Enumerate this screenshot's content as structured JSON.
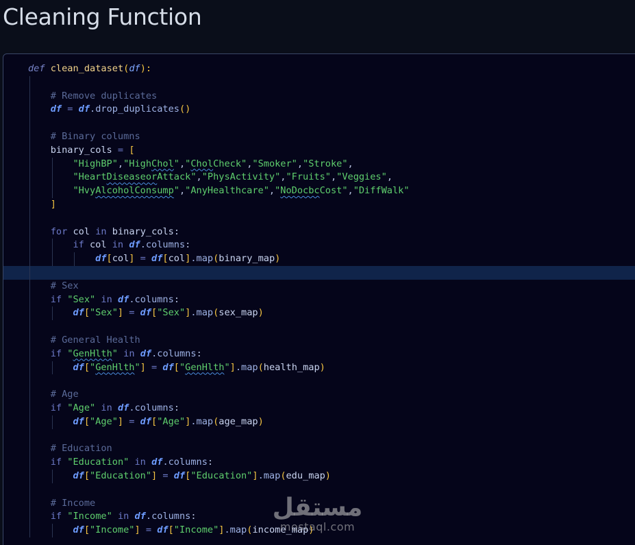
{
  "page": {
    "title": "Cleaning Function"
  },
  "code_lines": [
    {
      "indent": 0,
      "guides": [],
      "tokens": [
        [
          "kw-def",
          "def "
        ],
        [
          "fn",
          "clean_dataset"
        ],
        [
          "br",
          "("
        ],
        [
          "param",
          "df"
        ],
        [
          "br",
          "):"
        ]
      ]
    },
    {
      "indent": 1,
      "guides": [
        1
      ],
      "tokens": []
    },
    {
      "indent": 1,
      "guides": [
        1
      ],
      "tokens": [
        [
          "cmt",
          "# Remove duplicates"
        ]
      ]
    },
    {
      "indent": 1,
      "guides": [
        1
      ],
      "tokens": [
        [
          "dfv",
          "df"
        ],
        [
          "op",
          " = "
        ],
        [
          "dfv",
          "df"
        ],
        [
          "meth",
          ".drop_duplicates"
        ],
        [
          "br",
          "()"
        ]
      ]
    },
    {
      "indent": 1,
      "guides": [
        1
      ],
      "tokens": []
    },
    {
      "indent": 1,
      "guides": [
        1
      ],
      "tokens": [
        [
          "cmt",
          "# Binary columns"
        ]
      ]
    },
    {
      "indent": 1,
      "guides": [
        1
      ],
      "tokens": [
        [
          "var",
          "binary_cols"
        ],
        [
          "op",
          " = "
        ],
        [
          "br",
          "["
        ]
      ]
    },
    {
      "indent": 2,
      "guides": [
        1,
        2
      ],
      "tokens": [
        [
          "str",
          "\"HighBP\""
        ],
        [
          "punc",
          ","
        ],
        [
          "str",
          "\"High"
        ],
        [
          "str squig",
          "Chol"
        ],
        [
          "str",
          "\""
        ],
        [
          "punc",
          ","
        ],
        [
          "str",
          "\""
        ],
        [
          "str squig",
          "Chol"
        ],
        [
          "str",
          "Check\""
        ],
        [
          "punc",
          ","
        ],
        [
          "str",
          "\"Smoker\""
        ],
        [
          "punc",
          ","
        ],
        [
          "str",
          "\"Stroke\""
        ],
        [
          "punc",
          ","
        ]
      ]
    },
    {
      "indent": 2,
      "guides": [
        1,
        2
      ],
      "tokens": [
        [
          "str",
          "\"Heart"
        ],
        [
          "str squig",
          "Diseaseor"
        ],
        [
          "str",
          "Attack\""
        ],
        [
          "punc",
          ","
        ],
        [
          "str",
          "\"PhysActivity\""
        ],
        [
          "punc",
          ","
        ],
        [
          "str",
          "\"Fruits\""
        ],
        [
          "punc",
          ","
        ],
        [
          "str",
          "\"Veggies\""
        ],
        [
          "punc",
          ","
        ]
      ]
    },
    {
      "indent": 2,
      "guides": [
        1,
        2
      ],
      "tokens": [
        [
          "str",
          "\"Hvy"
        ],
        [
          "str squig",
          "AlcoholConsump"
        ],
        [
          "str",
          "\""
        ],
        [
          "punc",
          ","
        ],
        [
          "str",
          "\"AnyHealthcare\""
        ],
        [
          "punc",
          ","
        ],
        [
          "str",
          "\""
        ],
        [
          "str squig",
          "NoDocbc"
        ],
        [
          "str",
          "Cost\""
        ],
        [
          "punc",
          ","
        ],
        [
          "str",
          "\"DiffWalk\""
        ]
      ]
    },
    {
      "indent": 1,
      "guides": [
        1
      ],
      "tokens": [
        [
          "br",
          "]"
        ]
      ]
    },
    {
      "indent": 1,
      "guides": [
        1
      ],
      "tokens": []
    },
    {
      "indent": 1,
      "guides": [
        1
      ],
      "tokens": [
        [
          "kw",
          "for "
        ],
        [
          "var",
          "col"
        ],
        [
          "kw",
          " in "
        ],
        [
          "var",
          "binary_cols"
        ],
        [
          "punc",
          ":"
        ]
      ]
    },
    {
      "indent": 2,
      "guides": [
        1,
        2
      ],
      "tokens": [
        [
          "kw",
          "if "
        ],
        [
          "var",
          "col"
        ],
        [
          "kw",
          " in "
        ],
        [
          "dfv",
          "df"
        ],
        [
          "meth",
          ".columns"
        ],
        [
          "punc",
          ":"
        ]
      ]
    },
    {
      "indent": 3,
      "guides": [
        1,
        2,
        3
      ],
      "tokens": [
        [
          "dfv",
          "df"
        ],
        [
          "br",
          "["
        ],
        [
          "var",
          "col"
        ],
        [
          "br",
          "]"
        ],
        [
          "op",
          " = "
        ],
        [
          "dfv",
          "df"
        ],
        [
          "br",
          "["
        ],
        [
          "var",
          "col"
        ],
        [
          "br",
          "]"
        ],
        [
          "meth",
          ".map"
        ],
        [
          "br",
          "("
        ],
        [
          "var",
          "binary_map"
        ],
        [
          "br",
          ")"
        ]
      ]
    },
    {
      "indent": 1,
      "guides": [
        1
      ],
      "active": true,
      "tokens": []
    },
    {
      "indent": 1,
      "guides": [
        1
      ],
      "tokens": [
        [
          "cmt",
          "# Sex"
        ]
      ]
    },
    {
      "indent": 1,
      "guides": [
        1
      ],
      "tokens": [
        [
          "kw",
          "if "
        ],
        [
          "str",
          "\"Sex\""
        ],
        [
          "kw",
          " in "
        ],
        [
          "dfv",
          "df"
        ],
        [
          "meth",
          ".columns"
        ],
        [
          "punc",
          ":"
        ]
      ]
    },
    {
      "indent": 2,
      "guides": [
        1,
        2
      ],
      "tokens": [
        [
          "dfv",
          "df"
        ],
        [
          "br",
          "["
        ],
        [
          "str",
          "\"Sex\""
        ],
        [
          "br",
          "]"
        ],
        [
          "op",
          " = "
        ],
        [
          "dfv",
          "df"
        ],
        [
          "br",
          "["
        ],
        [
          "str",
          "\"Sex\""
        ],
        [
          "br",
          "]"
        ],
        [
          "meth",
          ".map"
        ],
        [
          "br",
          "("
        ],
        [
          "var",
          "sex_map"
        ],
        [
          "br",
          ")"
        ]
      ]
    },
    {
      "indent": 1,
      "guides": [
        1
      ],
      "tokens": []
    },
    {
      "indent": 1,
      "guides": [
        1
      ],
      "tokens": [
        [
          "cmt",
          "# General Health"
        ]
      ]
    },
    {
      "indent": 1,
      "guides": [
        1
      ],
      "tokens": [
        [
          "kw",
          "if "
        ],
        [
          "str",
          "\""
        ],
        [
          "str squig",
          "GenHlth"
        ],
        [
          "str",
          "\""
        ],
        [
          "kw",
          " in "
        ],
        [
          "dfv",
          "df"
        ],
        [
          "meth",
          ".columns"
        ],
        [
          "punc",
          ":"
        ]
      ]
    },
    {
      "indent": 2,
      "guides": [
        1,
        2
      ],
      "tokens": [
        [
          "dfv",
          "df"
        ],
        [
          "br",
          "["
        ],
        [
          "str",
          "\""
        ],
        [
          "str squig",
          "GenHlth"
        ],
        [
          "str",
          "\""
        ],
        [
          "br",
          "]"
        ],
        [
          "op",
          " = "
        ],
        [
          "dfv",
          "df"
        ],
        [
          "br",
          "["
        ],
        [
          "str",
          "\""
        ],
        [
          "str squig",
          "GenHlth"
        ],
        [
          "str",
          "\""
        ],
        [
          "br",
          "]"
        ],
        [
          "meth",
          ".map"
        ],
        [
          "br",
          "("
        ],
        [
          "var",
          "health_map"
        ],
        [
          "br",
          ")"
        ]
      ]
    },
    {
      "indent": 1,
      "guides": [
        1
      ],
      "tokens": []
    },
    {
      "indent": 1,
      "guides": [
        1
      ],
      "tokens": [
        [
          "cmt",
          "# Age"
        ]
      ]
    },
    {
      "indent": 1,
      "guides": [
        1
      ],
      "tokens": [
        [
          "kw",
          "if "
        ],
        [
          "str",
          "\"Age\""
        ],
        [
          "kw",
          " in "
        ],
        [
          "dfv",
          "df"
        ],
        [
          "meth",
          ".columns"
        ],
        [
          "punc",
          ":"
        ]
      ]
    },
    {
      "indent": 2,
      "guides": [
        1,
        2
      ],
      "tokens": [
        [
          "dfv",
          "df"
        ],
        [
          "br",
          "["
        ],
        [
          "str",
          "\"Age\""
        ],
        [
          "br",
          "]"
        ],
        [
          "op",
          " = "
        ],
        [
          "dfv",
          "df"
        ],
        [
          "br",
          "["
        ],
        [
          "str",
          "\"Age\""
        ],
        [
          "br",
          "]"
        ],
        [
          "meth",
          ".map"
        ],
        [
          "br",
          "("
        ],
        [
          "var",
          "age_map"
        ],
        [
          "br",
          ")"
        ]
      ]
    },
    {
      "indent": 1,
      "guides": [
        1
      ],
      "tokens": []
    },
    {
      "indent": 1,
      "guides": [
        1
      ],
      "tokens": [
        [
          "cmt",
          "# Education"
        ]
      ]
    },
    {
      "indent": 1,
      "guides": [
        1
      ],
      "tokens": [
        [
          "kw",
          "if "
        ],
        [
          "str",
          "\"Education\""
        ],
        [
          "kw",
          " in "
        ],
        [
          "dfv",
          "df"
        ],
        [
          "meth",
          ".columns"
        ],
        [
          "punc",
          ":"
        ]
      ]
    },
    {
      "indent": 2,
      "guides": [
        1,
        2
      ],
      "tokens": [
        [
          "dfv",
          "df"
        ],
        [
          "br",
          "["
        ],
        [
          "str",
          "\"Education\""
        ],
        [
          "br",
          "]"
        ],
        [
          "op",
          " = "
        ],
        [
          "dfv",
          "df"
        ],
        [
          "br",
          "["
        ],
        [
          "str",
          "\"Education\""
        ],
        [
          "br",
          "]"
        ],
        [
          "meth",
          ".map"
        ],
        [
          "br",
          "("
        ],
        [
          "var",
          "edu_map"
        ],
        [
          "br",
          ")"
        ]
      ]
    },
    {
      "indent": 1,
      "guides": [
        1
      ],
      "tokens": []
    },
    {
      "indent": 1,
      "guides": [
        1
      ],
      "tokens": [
        [
          "cmt",
          "# Income"
        ]
      ]
    },
    {
      "indent": 1,
      "guides": [
        1
      ],
      "tokens": [
        [
          "kw",
          "if "
        ],
        [
          "str",
          "\"Income\""
        ],
        [
          "kw",
          " in "
        ],
        [
          "dfv",
          "df"
        ],
        [
          "meth",
          ".columns"
        ],
        [
          "punc",
          ":"
        ]
      ]
    },
    {
      "indent": 2,
      "guides": [
        1,
        2
      ],
      "tokens": [
        [
          "dfv",
          "df"
        ],
        [
          "br",
          "["
        ],
        [
          "str",
          "\"Income\""
        ],
        [
          "br",
          "]"
        ],
        [
          "op",
          " = "
        ],
        [
          "dfv",
          "df"
        ],
        [
          "br",
          "["
        ],
        [
          "str",
          "\"Income\""
        ],
        [
          "br",
          "]"
        ],
        [
          "meth",
          ".map"
        ],
        [
          "br",
          "("
        ],
        [
          "var",
          "income_map"
        ],
        [
          "br",
          ")"
        ]
      ]
    }
  ],
  "watermark": {
    "logo": "مستقل",
    "url": "mostaql.com"
  }
}
